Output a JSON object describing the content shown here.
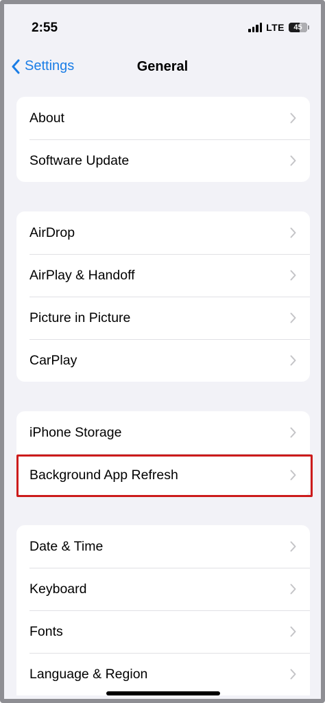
{
  "status_bar": {
    "time": "2:55",
    "network": "LTE",
    "battery": "45"
  },
  "nav": {
    "back_label": "Settings",
    "title": "General"
  },
  "groups": [
    {
      "items": [
        {
          "label": "About"
        },
        {
          "label": "Software Update"
        }
      ]
    },
    {
      "items": [
        {
          "label": "AirDrop"
        },
        {
          "label": "AirPlay & Handoff"
        },
        {
          "label": "Picture in Picture"
        },
        {
          "label": "CarPlay"
        }
      ]
    },
    {
      "items": [
        {
          "label": "iPhone Storage"
        },
        {
          "label": "Background App Refresh"
        }
      ]
    },
    {
      "items": [
        {
          "label": "Date & Time"
        },
        {
          "label": "Keyboard"
        },
        {
          "label": "Fonts"
        },
        {
          "label": "Language & Region"
        }
      ]
    }
  ],
  "colors": {
    "accent": "#1a7de6",
    "highlight": "#cc1b1b",
    "background": "#f2f2f7"
  }
}
